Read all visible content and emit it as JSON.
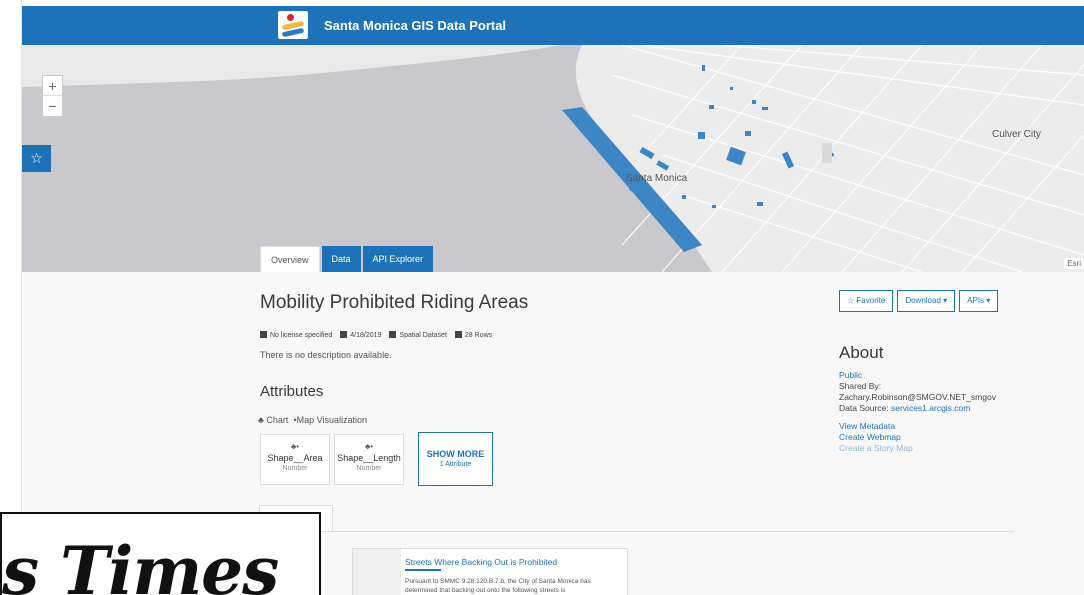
{
  "header": {
    "title": "Santa Monica GIS Data Portal"
  },
  "map": {
    "zoom_in": "+",
    "zoom_out": "−",
    "favorite_icon": "☆",
    "label_santa_monica": "Santa Monica",
    "label_culver_city": "Culver City",
    "attribution": "Esri"
  },
  "tabs": [
    "Overview",
    "Data",
    "API Explorer"
  ],
  "dataset": {
    "title": "Mobility Prohibited Riding Areas",
    "license": "No license specified",
    "date": "4/18/2019",
    "type": "Spatial Dataset",
    "rows": "28 Rows",
    "description": "There is no description available."
  },
  "attributes": {
    "heading": "Attributes",
    "viz_chart": "Chart",
    "viz_map": "Map Visualization",
    "cards": [
      {
        "name": "Shape__Area",
        "type": "Number"
      },
      {
        "name": "Shape__Length",
        "type": "Number"
      }
    ],
    "show_more": "SHOW MORE",
    "show_more_sub": "1 Attribute"
  },
  "actions": {
    "favorite": "Favorite",
    "download": "Download",
    "apis": "APIs"
  },
  "about": {
    "heading": "About",
    "access": "Public",
    "shared_by_label": "Shared By:",
    "shared_by": "Zachary.Robinson@SMGOV.NET_smgov",
    "data_source_label": "Data Source:",
    "data_source": "services1.arcgis.com",
    "view_metadata": "View Metadata",
    "create_webmap": "Create Webmap",
    "create_story_map": "Create a Story Map"
  },
  "story": {
    "title": "Streets Where Backing Out is Prohibited",
    "description": "Pursuant to SMMC 9.28.120.B.7.b, the City of Santa Monica has determined that backing out onto the following streets is"
  },
  "overlay": {
    "text": "s Times"
  },
  "colors": {
    "brand": "#1e73b8",
    "ocean": "#c8c8cc",
    "land": "#e4e4e4",
    "feature": "#3d86c6"
  }
}
